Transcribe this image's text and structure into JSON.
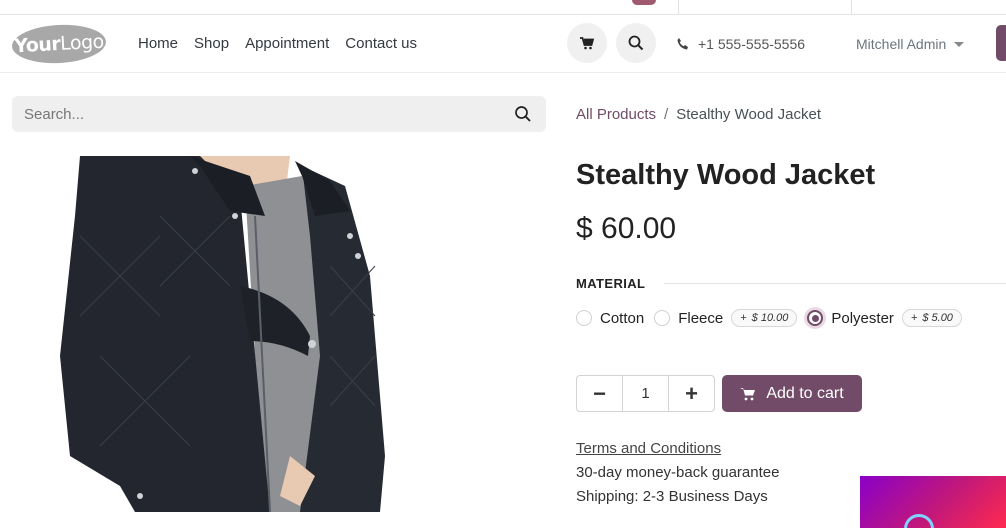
{
  "header": {
    "logo_text_bold": "Your",
    "logo_text": "Logo",
    "nav": [
      {
        "label": "Home"
      },
      {
        "label": "Shop"
      },
      {
        "label": "Appointment"
      },
      {
        "label": "Contact us"
      }
    ],
    "phone": "+1 555-555-5556",
    "user": "Mitchell Admin",
    "icons": {
      "cart": "cart-icon",
      "search": "search-icon",
      "phone": "phone-icon"
    }
  },
  "search": {
    "placeholder": "Search..."
  },
  "breadcrumb": {
    "parent": "All Products",
    "separator": "/",
    "current": "Stealthy Wood Jacket"
  },
  "product": {
    "title": "Stealthy Wood Jacket",
    "price": "$ 60.00",
    "attribute": {
      "label": "MATERIAL",
      "options": [
        {
          "name": "Cotton",
          "selected": false,
          "extra": null
        },
        {
          "name": "Fleece",
          "selected": false,
          "extra_sign": "+",
          "extra": "$ 10.00"
        },
        {
          "name": "Polyester",
          "selected": true,
          "extra_sign": "+",
          "extra": "$ 5.00"
        }
      ]
    },
    "quantity": "1",
    "qty_minus": "−",
    "qty_plus": "+",
    "add_to_cart": "Add to cart",
    "terms": "Terms and Conditions",
    "guarantee": "30-day money-back guarantee",
    "shipping": "Shipping: 2-3 Business Days"
  },
  "colors": {
    "accent": "#714b67",
    "text": "#212529"
  }
}
